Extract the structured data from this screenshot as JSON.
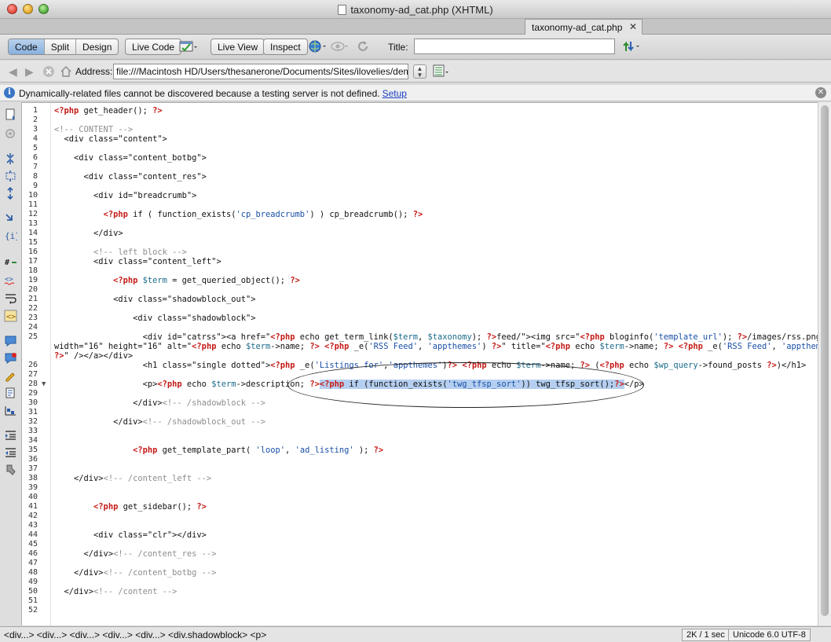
{
  "window": {
    "title": "taxonomy-ad_cat.php (XHTML)",
    "tab_label": "taxonomy-ad_cat.php",
    "tab_close": "✕"
  },
  "toolbar": {
    "view_buttons": [
      "Code",
      "Split",
      "Design"
    ],
    "active_view": "Code",
    "live_code": "Live Code",
    "live_view": "Live View",
    "inspect": "Inspect",
    "title_label": "Title:",
    "title_value": ""
  },
  "address": {
    "label": "Address:",
    "value": "file:///Macintosh HD/Users/thesanerone/Documents/Sites/ilovelies/demo/w"
  },
  "infobar": {
    "message": "Dynamically-related files cannot be discovered because a testing server is not defined.",
    "link": "Setup"
  },
  "editor": {
    "lines": [
      {
        "n": "1",
        "html": "<span class='tk-php'>&lt;?php</span> get_header(); <span class='tk-php'>?&gt;</span>"
      },
      {
        "n": "2",
        "html": ""
      },
      {
        "n": "3",
        "html": "<span class='tk-cm'>&lt;!-- CONTENT --&gt;</span>"
      },
      {
        "n": "4",
        "html": "  &lt;div class=\"content\"&gt;"
      },
      {
        "n": "5",
        "html": ""
      },
      {
        "n": "6",
        "html": "    &lt;div class=\"content_botbg\"&gt;"
      },
      {
        "n": "7",
        "html": ""
      },
      {
        "n": "8",
        "html": "      &lt;div class=\"content_res\"&gt;"
      },
      {
        "n": "9",
        "html": ""
      },
      {
        "n": "10",
        "html": "        &lt;div id=\"breadcrumb\"&gt;"
      },
      {
        "n": "11",
        "html": ""
      },
      {
        "n": "12",
        "html": "          <span class='tk-php'>&lt;?php</span> if ( function_exists(<span class='tk-str'>'cp_breadcrumb'</span>) ) cp_breadcrumb(); <span class='tk-php'>?&gt;</span>"
      },
      {
        "n": "13",
        "html": ""
      },
      {
        "n": "14",
        "html": "        &lt;/div&gt;"
      },
      {
        "n": "15",
        "html": ""
      },
      {
        "n": "16",
        "html": "        <span class='tk-cm'>&lt;!-- left block --&gt;</span>"
      },
      {
        "n": "17",
        "html": "        &lt;div class=\"content_left\"&gt;"
      },
      {
        "n": "18",
        "html": ""
      },
      {
        "n": "19",
        "html": "            <span class='tk-php'>&lt;?php</span> <span class='tk-var'>$term</span> = get_queried_object(); <span class='tk-php'>?&gt;</span>"
      },
      {
        "n": "20",
        "html": ""
      },
      {
        "n": "21",
        "html": "            &lt;div class=\"shadowblock_out\"&gt;"
      },
      {
        "n": "22",
        "html": ""
      },
      {
        "n": "23",
        "html": "                &lt;div class=\"shadowblock\"&gt;"
      },
      {
        "n": "24",
        "html": ""
      },
      {
        "n": "25",
        "html": "                  &lt;div id=\"catrss\"&gt;&lt;a href=\"<span class='tk-php'>&lt;?php</span> echo get_term_link(<span class='tk-var'>$term</span>, <span class='tk-var'>$taxonomy</span>); <span class='tk-php'>?&gt;</span>feed/\"&gt;&lt;img src=\"<span class='tk-php'>&lt;?php</span> bloginfo(<span class='tk-str'>'template_url'</span>); <span class='tk-php'>?&gt;</span>/images/rss.png\""
      },
      {
        "n": "",
        "html": "width=\"16\" height=\"16\" alt=\"<span class='tk-php'>&lt;?php</span> echo <span class='tk-var'>$term</span>-&gt;name; <span class='tk-php'>?&gt;</span> <span class='tk-php'>&lt;?php</span> _e(<span class='tk-str'>'RSS Feed'</span>, <span class='tk-str'>'appthemes'</span>) <span class='tk-php'>?&gt;</span>\" title=\"<span class='tk-php'>&lt;?php</span> echo <span class='tk-var'>$term</span>-&gt;name; <span class='tk-php'>?&gt;</span> <span class='tk-php'>&lt;?php</span> _e(<span class='tk-str'>'RSS Feed'</span>, <span class='tk-str'>'appthemes'</span>)",
        "wrap": true
      },
      {
        "n": "",
        "html": "<span class='tk-php'>?&gt;</span>\" /&gt;&lt;/a&gt;&lt;/div&gt;",
        "wrap": true
      },
      {
        "n": "26",
        "html": "                  &lt;h1 class=\"single dotted\"&gt;<span class='tk-php'>&lt;?php</span> _e(<span class='tk-str'>'Listings for'</span>,<span class='tk-str'>'appthemes'</span>)<span class='tk-php'>?&gt;</span> <span class='tk-php'>&lt;?php</span> echo <span class='tk-var'>$term</span>-&gt;name; <span class='tk-php'>?&gt;</span> (<span class='tk-php'>&lt;?php</span> echo <span class='tk-var'>$wp_query</span>-&gt;found_posts <span class='tk-php'>?&gt;</span>)&lt;/h1&gt;"
      },
      {
        "n": "27",
        "html": ""
      },
      {
        "n": "28",
        "fold": true,
        "html": "                  &lt;p&gt;<span class='tk-php'>&lt;?php</span> echo <span class='tk-var'>$term</span>-&gt;description; <span class='tk-php'>?&gt;</span><span class='hl'><span class='tk-php'>&lt;?php</span> if (function_exists(<span class='tk-str'>'twg_tfsp_sort'</span>)) twg_tfsp_sort();<span class='tk-php'>?&gt;</span></span>&lt;/p&gt;"
      },
      {
        "n": "29",
        "html": ""
      },
      {
        "n": "30",
        "html": "                &lt;/div&gt;<span class='tk-cm'>&lt;!-- /shadowblock --&gt;</span>"
      },
      {
        "n": "31",
        "html": ""
      },
      {
        "n": "32",
        "html": "            &lt;/div&gt;<span class='tk-cm'>&lt;!-- /shadowblock_out --&gt;</span>"
      },
      {
        "n": "33",
        "html": ""
      },
      {
        "n": "34",
        "html": ""
      },
      {
        "n": "35",
        "html": "                <span class='tk-php'>&lt;?php</span> get_template_part( <span class='tk-str'>'loop'</span>, <span class='tk-str'>'ad_listing'</span> ); <span class='tk-php'>?&gt;</span>"
      },
      {
        "n": "36",
        "html": ""
      },
      {
        "n": "37",
        "html": ""
      },
      {
        "n": "38",
        "html": "    &lt;/div&gt;<span class='tk-cm'>&lt;!-- /content_left --&gt;</span>"
      },
      {
        "n": "39",
        "html": ""
      },
      {
        "n": "40",
        "html": ""
      },
      {
        "n": "41",
        "html": "        <span class='tk-php'>&lt;?php</span> get_sidebar(); <span class='tk-php'>?&gt;</span>"
      },
      {
        "n": "42",
        "html": ""
      },
      {
        "n": "43",
        "html": ""
      },
      {
        "n": "44",
        "html": "        &lt;div class=\"clr\"&gt;&lt;/div&gt;"
      },
      {
        "n": "45",
        "html": ""
      },
      {
        "n": "46",
        "html": "      &lt;/div&gt;<span class='tk-cm'>&lt;!-- /content_res --&gt;</span>"
      },
      {
        "n": "47",
        "html": ""
      },
      {
        "n": "48",
        "html": "    &lt;/div&gt;<span class='tk-cm'>&lt;!-- /content_botbg --&gt;</span>"
      },
      {
        "n": "49",
        "html": ""
      },
      {
        "n": "50",
        "html": "  &lt;/div&gt;<span class='tk-cm'>&lt;!-- /content --&gt;</span>"
      },
      {
        "n": "51",
        "html": ""
      },
      {
        "n": "52",
        "html": ""
      }
    ]
  },
  "statusbar": {
    "tag_selector": "<div...> <div...> <div...> <div...> <div...> <div.shadowblock> <p>",
    "download_stats": "2K / 1 sec",
    "encoding": "Unicode 6.0 UTF-8"
  }
}
